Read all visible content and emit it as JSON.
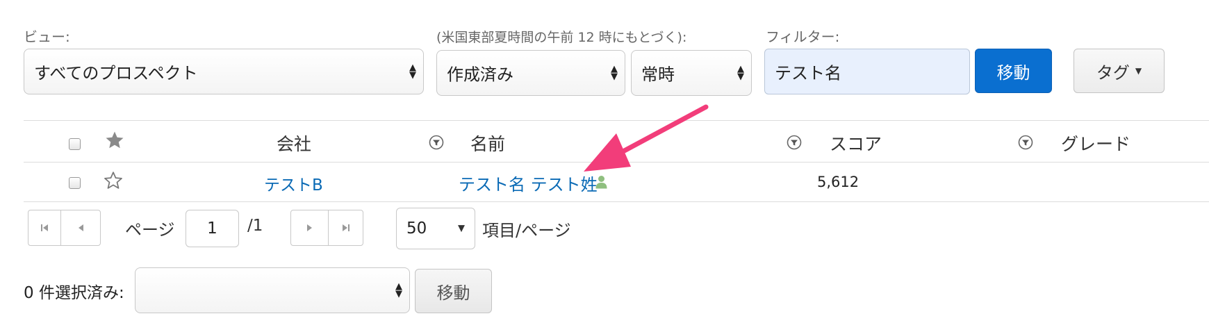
{
  "view": {
    "label": "ビュー:",
    "value": "すべてのプロスペクト"
  },
  "date_filter": {
    "label": "(米国東部夏時間の午前 12 時にもとづく):",
    "field_value": "作成済み",
    "range_value": "常時"
  },
  "filter": {
    "label": "フィルター:",
    "value": "テスト名",
    "go_label": "移動"
  },
  "tag_label": "タグ",
  "table": {
    "headers": {
      "company": "会社",
      "name": "名前",
      "score": "スコア",
      "grade": "グレード"
    },
    "rows": [
      {
        "company": "テストB",
        "name": "テスト名 テスト姓",
        "score": "5,612",
        "grade": ""
      }
    ]
  },
  "pagination": {
    "page_label": "ページ",
    "page_value": "1",
    "total": "/1",
    "per_page": "50",
    "per_page_label": "項目/ページ"
  },
  "bulk": {
    "selected_label": "0 件選択済み:",
    "action_value": "",
    "go_label": "移動"
  },
  "colors": {
    "link": "#0a6ab5",
    "primary_button": "#0a6fd0",
    "annotation_arrow": "#f23d7a",
    "filter_input_bg": "#e8f0fd",
    "prospect_icon": "#8fbf7f"
  },
  "icons": [
    "star-filled-icon",
    "star-outline-icon",
    "filter-icon",
    "person-icon",
    "first-page-icon",
    "prev-page-icon",
    "next-page-icon",
    "last-page-icon"
  ]
}
